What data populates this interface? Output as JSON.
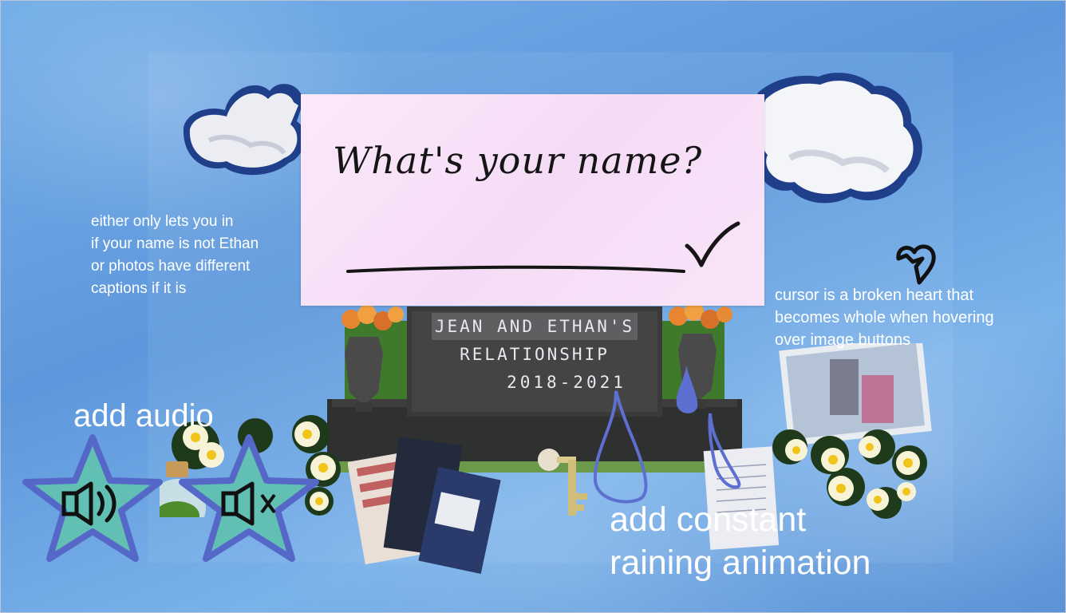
{
  "card": {
    "title": "What's your name?",
    "name_value": "",
    "name_placeholder": "",
    "submit_icon": "checkmark-icon"
  },
  "tombstone": {
    "line1": "JEAN AND ETHAN'S",
    "line2": "RELATIONSHIP",
    "line3": "2018-2021"
  },
  "notes": {
    "left": "either only lets you in\nif your name is not Ethan\nor photos have different\ncaptions if it is",
    "right": "cursor is a broken heart that\nbecomes whole when hovering\nover image buttons",
    "audio": "add audio",
    "rain": "add constant\nraining animation"
  },
  "audio_buttons": {
    "sound_on_icon": "speaker-on-icon",
    "sound_off_icon": "speaker-muted-icon"
  },
  "colors": {
    "background": "#6fa3df",
    "card": "#f8e4f9",
    "star_fill": "#62bfb3",
    "star_border": "#5568c8",
    "rain_drop": "#5d6fd0"
  }
}
